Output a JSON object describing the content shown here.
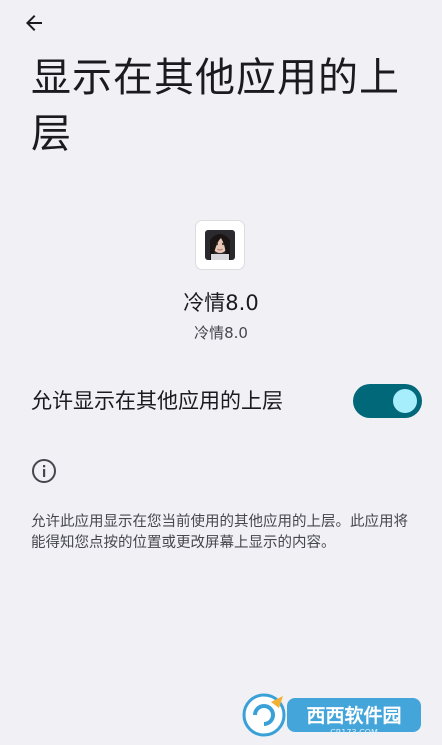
{
  "header": {
    "back_icon": "arrow-left-icon",
    "title": "显示在其他应用的上层"
  },
  "app": {
    "icon": "app-avatar-icon",
    "name": "冷情8.0",
    "package_label": "冷情8.0"
  },
  "permission": {
    "label": "允许显示在其他应用的上层",
    "enabled": true
  },
  "info": {
    "icon": "info-icon",
    "text": "允许此应用显示在您当前使用的其他应用的上层。此应用将能得知您点按的位置或更改屏幕上显示的内容。"
  },
  "watermark": {
    "text": "西西软件园",
    "url_text": "CR173.COM"
  },
  "colors": {
    "background": "#f1f0f4",
    "switch_track": "#006878",
    "switch_thumb": "#a6eefc"
  }
}
